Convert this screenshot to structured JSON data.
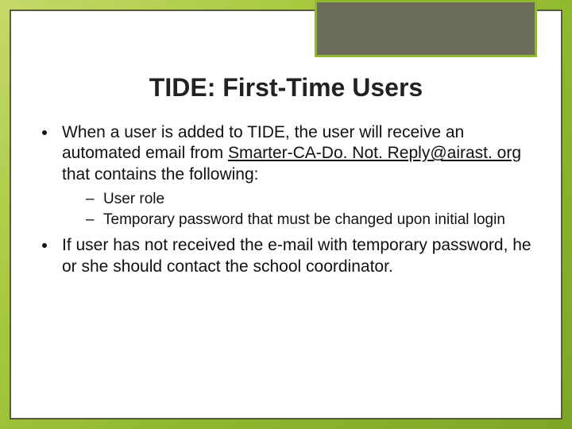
{
  "title": "TIDE: First-Time Users",
  "bullets": {
    "b1_pre": "When a user is added to TIDE, the user will receive an automated email from ",
    "b1_link": "Smarter-CA-Do. Not. Reply@airast. org",
    "b1_post": " that contains the following:",
    "sub1": "User role",
    "sub2": "Temporary password that must be changed upon initial login",
    "b2": "If user has not received the e-mail with temporary password, he or she should contact the school coordinator."
  }
}
